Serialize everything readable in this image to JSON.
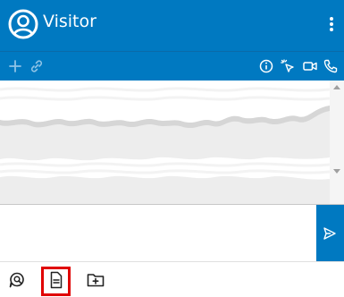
{
  "header": {
    "title": "Visitor",
    "avatar_icon": "user-circle-icon",
    "menu_icon": "kebab-menu-icon"
  },
  "toolbar": {
    "left_icons": [
      "plus-icon",
      "link-icon"
    ],
    "right_icons": [
      "info-icon",
      "cursor-click-icon",
      "video-camera-icon",
      "phone-icon"
    ]
  },
  "composer": {
    "placeholder": "",
    "value": "",
    "send_icon": "send-icon"
  },
  "footer": {
    "icons": [
      "chat-search-icon",
      "document-icon",
      "folder-add-icon"
    ]
  },
  "colors": {
    "primary": "#0079c1",
    "highlight": "#e00000"
  }
}
